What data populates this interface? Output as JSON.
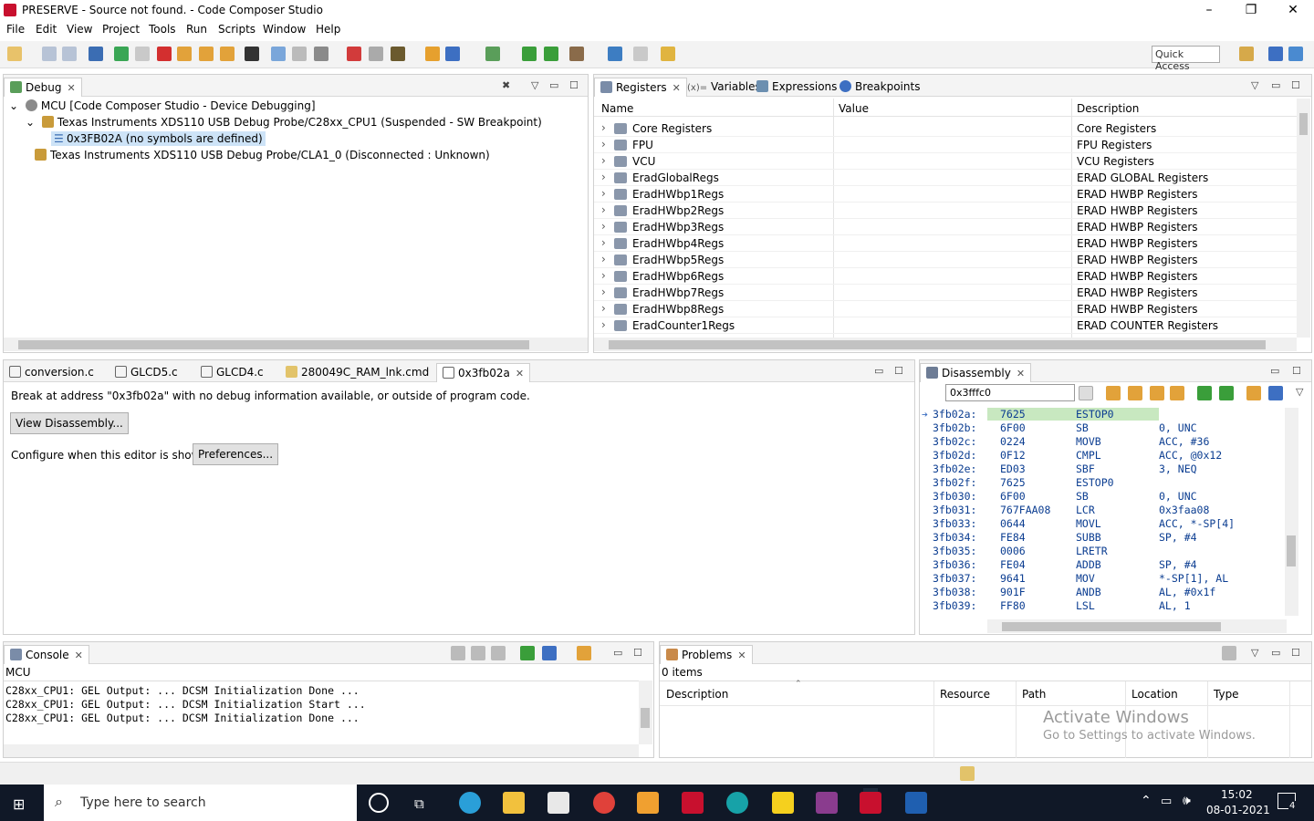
{
  "window": {
    "title": "PRESERVE - Source not found. - Code Composer Studio",
    "minimize": "–",
    "maximize": "❐",
    "close": "✕"
  },
  "menu": [
    "File",
    "Edit",
    "View",
    "Project",
    "Tools",
    "Run",
    "Scripts",
    "Window",
    "Help"
  ],
  "quick_access": "Quick Access",
  "debug": {
    "tab": "Debug",
    "tree": [
      "MCU [Code Composer Studio - Device Debugging]",
      "Texas Instruments XDS110 USB Debug Probe/C28xx_CPU1 (Suspended - SW Breakpoint)",
      "0x3FB02A  (no symbols are defined)",
      "Texas Instruments XDS110 USB Debug Probe/CLA1_0 (Disconnected : Unknown)"
    ]
  },
  "registers": {
    "tabs": [
      "Registers",
      "Variables",
      "Expressions",
      "Breakpoints"
    ],
    "tab_prefix_variables": "(x)=",
    "columns": [
      "Name",
      "Value",
      "Description"
    ],
    "rows": [
      {
        "name": "Core Registers",
        "desc": "Core Registers"
      },
      {
        "name": "FPU",
        "desc": "FPU Registers"
      },
      {
        "name": "VCU",
        "desc": "VCU Registers"
      },
      {
        "name": "EradGlobalRegs",
        "desc": "ERAD GLOBAL Registers"
      },
      {
        "name": "EradHWbp1Regs",
        "desc": "ERAD HWBP Registers"
      },
      {
        "name": "EradHWbp2Regs",
        "desc": "ERAD HWBP Registers"
      },
      {
        "name": "EradHWbp3Regs",
        "desc": "ERAD HWBP Registers"
      },
      {
        "name": "EradHWbp4Regs",
        "desc": "ERAD HWBP Registers"
      },
      {
        "name": "EradHWbp5Regs",
        "desc": "ERAD HWBP Registers"
      },
      {
        "name": "EradHWbp6Regs",
        "desc": "ERAD HWBP Registers"
      },
      {
        "name": "EradHWbp7Regs",
        "desc": "ERAD HWBP Registers"
      },
      {
        "name": "EradHWbp8Regs",
        "desc": "ERAD HWBP Registers"
      },
      {
        "name": "EradCounter1Regs",
        "desc": "ERAD COUNTER Registers"
      }
    ]
  },
  "editor": {
    "tabs": [
      "conversion.c",
      "GLCD5.c",
      "GLCD4.c",
      "280049C_RAM_lnk.cmd",
      "0x3fb02a"
    ],
    "message": "Break at address \"0x3fb02a\" with no debug information available, or outside of program code.",
    "view_disassembly": "View Disassembly...",
    "configure_label": "Configure when this editor is shown",
    "preferences": "Preferences..."
  },
  "disassembly": {
    "tab": "Disassembly",
    "address": "0x3fffc0",
    "lines": [
      [
        "3fb02a:",
        "7625",
        "ESTOP0",
        ""
      ],
      [
        "3fb02b:",
        "6F00",
        "SB",
        "0, UNC"
      ],
      [
        "3fb02c:",
        "0224",
        "MOVB",
        "ACC, #36"
      ],
      [
        "3fb02d:",
        "0F12",
        "CMPL",
        "ACC, @0x12"
      ],
      [
        "3fb02e:",
        "ED03",
        "SBF",
        "3, NEQ"
      ],
      [
        "3fb02f:",
        "7625",
        "ESTOP0",
        ""
      ],
      [
        "3fb030:",
        "6F00",
        "SB",
        "0, UNC"
      ],
      [
        "3fb031:",
        "767FAA08",
        "LCR",
        "0x3faa08"
      ],
      [
        "3fb033:",
        "0644",
        "MOVL",
        "ACC, *-SP[4]"
      ],
      [
        "3fb034:",
        "FE84",
        "SUBB",
        "SP, #4"
      ],
      [
        "3fb035:",
        "0006",
        "LRETR",
        ""
      ],
      [
        "3fb036:",
        "FE04",
        "ADDB",
        "SP, #4"
      ],
      [
        "3fb037:",
        "9641",
        "MOV",
        "*-SP[1], AL"
      ],
      [
        "3fb038:",
        "901F",
        "ANDB",
        "AL, #0x1f"
      ],
      [
        "3fb039:",
        "FF80",
        "LSL",
        "AL, 1"
      ]
    ]
  },
  "console": {
    "tab": "Console",
    "target": "MCU",
    "lines": [
      "C28xx_CPU1: GEL Output: ... DCSM Initialization Done ...",
      "C28xx_CPU1: GEL Output: ... DCSM Initialization Start ...",
      "C28xx_CPU1: GEL Output: ... DCSM Initialization Done ..."
    ]
  },
  "problems": {
    "tab": "Problems",
    "count": "0 items",
    "columns": [
      "Description",
      "Resource",
      "Path",
      "Location",
      "Type"
    ]
  },
  "watermark": {
    "title": "Activate Windows",
    "subtitle": "Go to Settings to activate Windows."
  },
  "taskbar": {
    "search": "Type here to search",
    "time": "15:02",
    "date": "08-01-2021",
    "notif": "4"
  }
}
